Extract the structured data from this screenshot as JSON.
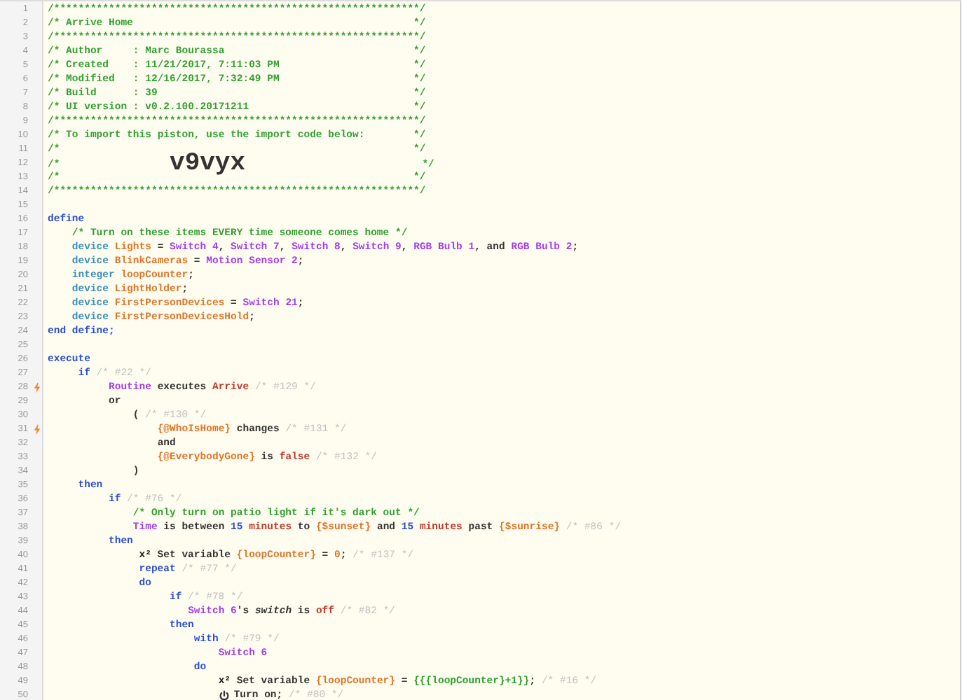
{
  "editor": {
    "lines": [
      {
        "number": "1",
        "kind": "code",
        "trigger": false,
        "tokens": [
          {
            "text": "/************************************************************/",
            "kind": "comment"
          }
        ]
      },
      {
        "number": "2",
        "kind": "code",
        "trigger": false,
        "tokens": [
          {
            "text": "/* Arrive Home                                              */",
            "kind": "comment"
          }
        ]
      },
      {
        "number": "3",
        "kind": "code",
        "trigger": false,
        "tokens": [
          {
            "text": "/************************************************************/",
            "kind": "comment"
          }
        ]
      },
      {
        "number": "4",
        "kind": "code",
        "trigger": false,
        "tokens": [
          {
            "text": "/* Author     : Marc Bourassa                               */",
            "kind": "comment"
          }
        ]
      },
      {
        "number": "5",
        "kind": "code",
        "trigger": false,
        "tokens": [
          {
            "text": "/* Created    : 11/21/2017, 7:11:03 PM                      */",
            "kind": "comment"
          }
        ]
      },
      {
        "number": "6",
        "kind": "code",
        "trigger": false,
        "tokens": [
          {
            "text": "/* Modified   : 12/16/2017, 7:32:49 PM                      */",
            "kind": "comment"
          }
        ]
      },
      {
        "number": "7",
        "kind": "code",
        "trigger": false,
        "tokens": [
          {
            "text": "/* Build      : 39                                          */",
            "kind": "comment"
          }
        ]
      },
      {
        "number": "8",
        "kind": "code",
        "trigger": false,
        "tokens": [
          {
            "text": "/* UI version : v0.2.100.20171211                           */",
            "kind": "comment"
          }
        ]
      },
      {
        "number": "9",
        "kind": "code",
        "trigger": false,
        "tokens": [
          {
            "text": "/************************************************************/",
            "kind": "comment"
          }
        ]
      },
      {
        "number": "10",
        "kind": "code",
        "trigger": false,
        "tokens": [
          {
            "text": "/* To import this piston, use the import code below:        */",
            "kind": "comment"
          }
        ]
      },
      {
        "number": "11",
        "kind": "code",
        "trigger": false,
        "tokens": [
          {
            "text": "/*                                                          */",
            "kind": "comment"
          }
        ]
      },
      {
        "number": "12",
        "kind": "code",
        "trigger": false,
        "tokens": [
          {
            "text": "/*                  ",
            "kind": "comment"
          },
          {
            "text": "v9vyx",
            "kind": "import-code"
          },
          {
            "text": "                             */",
            "kind": "comment"
          }
        ]
      },
      {
        "number": "13",
        "kind": "code",
        "trigger": false,
        "tokens": [
          {
            "text": "/*                                                          */",
            "kind": "comment"
          }
        ]
      },
      {
        "number": "14",
        "kind": "code",
        "trigger": false,
        "tokens": [
          {
            "text": "/************************************************************/",
            "kind": "comment"
          }
        ]
      },
      {
        "number": "15",
        "kind": "blank",
        "trigger": false
      },
      {
        "number": "16",
        "kind": "code",
        "trigger": false,
        "tokens": [
          {
            "text": "define",
            "kind": "keyword"
          }
        ]
      },
      {
        "number": "17",
        "kind": "code",
        "trigger": false,
        "tokens": [
          {
            "text": "    /* Turn on these items EVERY time someone comes home */",
            "kind": "comment"
          }
        ]
      },
      {
        "number": "18",
        "kind": "code",
        "trigger": false,
        "tokens": [
          {
            "text": "    device ",
            "kind": "type"
          },
          {
            "text": "Lights",
            "kind": "variable"
          },
          {
            "text": " = ",
            "kind": "plain"
          },
          {
            "text": "Switch 4",
            "kind": "device"
          },
          {
            "text": ", ",
            "kind": "plain"
          },
          {
            "text": "Switch 7",
            "kind": "device"
          },
          {
            "text": ", ",
            "kind": "plain"
          },
          {
            "text": "Switch 8",
            "kind": "device"
          },
          {
            "text": ", ",
            "kind": "plain"
          },
          {
            "text": "Switch 9",
            "kind": "device"
          },
          {
            "text": ", ",
            "kind": "plain"
          },
          {
            "text": "RGB Bulb 1",
            "kind": "device"
          },
          {
            "text": ", and ",
            "kind": "plain"
          },
          {
            "text": "RGB Bulb 2",
            "kind": "device"
          },
          {
            "text": ";",
            "kind": "plain"
          }
        ]
      },
      {
        "number": "19",
        "kind": "code",
        "trigger": false,
        "tokens": [
          {
            "text": "    device ",
            "kind": "type"
          },
          {
            "text": "BlinkCameras",
            "kind": "variable"
          },
          {
            "text": " = ",
            "kind": "plain"
          },
          {
            "text": "Motion Sensor 2",
            "kind": "device"
          },
          {
            "text": ";",
            "kind": "plain"
          }
        ]
      },
      {
        "number": "20",
        "kind": "code",
        "trigger": false,
        "tokens": [
          {
            "text": "    integer ",
            "kind": "type"
          },
          {
            "text": "loopCounter",
            "kind": "variable"
          },
          {
            "text": ";",
            "kind": "plain"
          }
        ]
      },
      {
        "number": "21",
        "kind": "code",
        "trigger": false,
        "tokens": [
          {
            "text": "    device ",
            "kind": "type"
          },
          {
            "text": "LightHolder",
            "kind": "variable"
          },
          {
            "text": ";",
            "kind": "plain"
          }
        ]
      },
      {
        "number": "22",
        "kind": "code",
        "trigger": false,
        "tokens": [
          {
            "text": "    device ",
            "kind": "type"
          },
          {
            "text": "FirstPersonDevices",
            "kind": "variable"
          },
          {
            "text": " = ",
            "kind": "plain"
          },
          {
            "text": "Switch 21",
            "kind": "device"
          },
          {
            "text": ";",
            "kind": "plain"
          }
        ]
      },
      {
        "number": "23",
        "kind": "code",
        "trigger": false,
        "tokens": [
          {
            "text": "    device ",
            "kind": "type"
          },
          {
            "text": "FirstPersonDevicesHold",
            "kind": "variable"
          },
          {
            "text": ";",
            "kind": "plain"
          }
        ]
      },
      {
        "number": "24",
        "kind": "code",
        "trigger": false,
        "tokens": [
          {
            "text": "end define;",
            "kind": "keyword"
          }
        ]
      },
      {
        "number": "25",
        "kind": "blank",
        "trigger": false
      },
      {
        "number": "26",
        "kind": "code",
        "trigger": false,
        "tokens": [
          {
            "text": "execute",
            "kind": "keyword"
          }
        ]
      },
      {
        "number": "27",
        "kind": "code",
        "trigger": false,
        "tokens": [
          {
            "text": "     if",
            "kind": "keyword"
          },
          {
            "text": " /* #22 */",
            "kind": "ref"
          }
        ]
      },
      {
        "number": "28",
        "kind": "code",
        "trigger": true,
        "tokens": [
          {
            "text": "          Routine",
            "kind": "device"
          },
          {
            "text": " executes ",
            "kind": "plain"
          },
          {
            "text": "Arrive",
            "kind": "value"
          },
          {
            "text": " /* #129 */",
            "kind": "ref"
          }
        ]
      },
      {
        "number": "29",
        "kind": "code",
        "trigger": false,
        "tokens": [
          {
            "text": "          or",
            "kind": "plain"
          }
        ]
      },
      {
        "number": "30",
        "kind": "code",
        "trigger": false,
        "tokens": [
          {
            "text": "              (",
            "kind": "plain"
          },
          {
            "text": " /* #130 */",
            "kind": "ref"
          }
        ]
      },
      {
        "number": "31",
        "kind": "code",
        "trigger": true,
        "tokens": [
          {
            "text": "                  {@WhoIsHome}",
            "kind": "variable"
          },
          {
            "text": " changes ",
            "kind": "plain"
          },
          {
            "text": "/* #131 */",
            "kind": "ref"
          }
        ]
      },
      {
        "number": "32",
        "kind": "code",
        "trigger": false,
        "tokens": [
          {
            "text": "                  and",
            "kind": "plain"
          }
        ]
      },
      {
        "number": "33",
        "kind": "code",
        "trigger": false,
        "tokens": [
          {
            "text": "                  {@EverybodyGone}",
            "kind": "variable"
          },
          {
            "text": " is ",
            "kind": "plain"
          },
          {
            "text": "false",
            "kind": "value"
          },
          {
            "text": " /* #132 */",
            "kind": "ref"
          }
        ]
      },
      {
        "number": "34",
        "kind": "code",
        "trigger": false,
        "tokens": [
          {
            "text": "              )",
            "kind": "plain"
          }
        ]
      },
      {
        "number": "35",
        "kind": "code",
        "trigger": false,
        "tokens": [
          {
            "text": "     then",
            "kind": "keyword"
          }
        ]
      },
      {
        "number": "36",
        "kind": "code",
        "trigger": false,
        "tokens": [
          {
            "text": "          if",
            "kind": "keyword"
          },
          {
            "text": " /* #76 */",
            "kind": "ref"
          }
        ]
      },
      {
        "number": "37",
        "kind": "code",
        "trigger": false,
        "tokens": [
          {
            "text": "              /* Only turn on patio light if it's dark out */",
            "kind": "comment"
          }
        ]
      },
      {
        "number": "38",
        "kind": "code",
        "trigger": false,
        "tokens": [
          {
            "text": "              Time",
            "kind": "device"
          },
          {
            "text": " is between ",
            "kind": "plain"
          },
          {
            "text": "15",
            "kind": "number"
          },
          {
            "text": " minutes",
            "kind": "value"
          },
          {
            "text": " to ",
            "kind": "plain"
          },
          {
            "text": "{$sunset}",
            "kind": "variable"
          },
          {
            "text": " and ",
            "kind": "plain"
          },
          {
            "text": "15",
            "kind": "number"
          },
          {
            "text": " minutes",
            "kind": "value"
          },
          {
            "text": " past ",
            "kind": "plain"
          },
          {
            "text": "{$sunrise}",
            "kind": "variable"
          },
          {
            "text": " /* #86 */",
            "kind": "ref"
          }
        ]
      },
      {
        "number": "39",
        "kind": "code",
        "trigger": false,
        "tokens": [
          {
            "text": "          then",
            "kind": "keyword"
          }
        ]
      },
      {
        "number": "40",
        "kind": "code",
        "trigger": false,
        "tokens": [
          {
            "text": "               x²",
            "kind": "symbol"
          },
          {
            "text": " Set variable ",
            "kind": "plain"
          },
          {
            "text": "{loopCounter}",
            "kind": "variable"
          },
          {
            "text": " = ",
            "kind": "plain"
          },
          {
            "text": "0",
            "kind": "variable"
          },
          {
            "text": "; ",
            "kind": "plain"
          },
          {
            "text": "/* #137 */",
            "kind": "ref"
          }
        ]
      },
      {
        "number": "41",
        "kind": "code",
        "trigger": false,
        "tokens": [
          {
            "text": "               repeat",
            "kind": "keyword"
          },
          {
            "text": " /* #77 */",
            "kind": "ref"
          }
        ]
      },
      {
        "number": "42",
        "kind": "code",
        "trigger": false,
        "tokens": [
          {
            "text": "               do",
            "kind": "keyword"
          }
        ]
      },
      {
        "number": "43",
        "kind": "code",
        "trigger": false,
        "tokens": [
          {
            "text": "                    if",
            "kind": "keyword"
          },
          {
            "text": " /* #78 */",
            "kind": "ref"
          }
        ]
      },
      {
        "number": "44",
        "kind": "code",
        "trigger": false,
        "tokens": [
          {
            "text": "                       Switch 6",
            "kind": "device"
          },
          {
            "text": "'s ",
            "kind": "plain"
          },
          {
            "text": "switch",
            "kind": "attribute"
          },
          {
            "text": " is ",
            "kind": "plain"
          },
          {
            "text": "off",
            "kind": "value"
          },
          {
            "text": " /* #82 */",
            "kind": "ref"
          }
        ]
      },
      {
        "number": "45",
        "kind": "code",
        "trigger": false,
        "tokens": [
          {
            "text": "                    then",
            "kind": "keyword"
          }
        ]
      },
      {
        "number": "46",
        "kind": "code",
        "trigger": false,
        "tokens": [
          {
            "text": "                        with",
            "kind": "keyword"
          },
          {
            "text": " /* #79 */",
            "kind": "ref"
          }
        ]
      },
      {
        "number": "47",
        "kind": "code",
        "trigger": false,
        "tokens": [
          {
            "text": "                            Switch 6",
            "kind": "device"
          }
        ]
      },
      {
        "number": "48",
        "kind": "code",
        "trigger": false,
        "tokens": [
          {
            "text": "                        do",
            "kind": "keyword"
          }
        ]
      },
      {
        "number": "49",
        "kind": "code",
        "trigger": false,
        "tokens": [
          {
            "text": "                            x²",
            "kind": "symbol"
          },
          {
            "text": " Set variable ",
            "kind": "plain"
          },
          {
            "text": "{loopCounter}",
            "kind": "variable"
          },
          {
            "text": " = ",
            "kind": "plain"
          },
          {
            "text": "{{{loopCounter}+1}}",
            "kind": "expression"
          },
          {
            "text": "; ",
            "kind": "plain"
          },
          {
            "text": "/* #16 */",
            "kind": "ref"
          }
        ]
      },
      {
        "number": "50",
        "kind": "action",
        "trigger": false,
        "tokens": [
          {
            "text": "                            Turn on;",
            "kind": "plain"
          },
          {
            "text": " /* #80 */",
            "kind": "ref"
          }
        ]
      }
    ]
  }
}
